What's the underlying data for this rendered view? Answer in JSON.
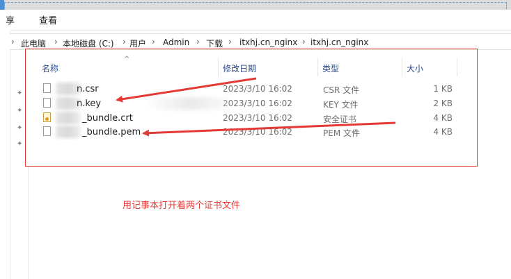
{
  "ribbon": {
    "tab1": "享",
    "tab2": "查看"
  },
  "breadcrumb": [
    "此电脑",
    "本地磁盘 (C:)",
    "用户",
    "Admin",
    "下载",
    "itxhj.cn_nginx",
    "itxhj.cn_nginx"
  ],
  "columns": {
    "name": "名称",
    "modified": "修改日期",
    "type": "类型",
    "size": "大小"
  },
  "files": [
    {
      "name": "n.csr",
      "modified": "2023/3/10 16:02",
      "type": "CSR 文件",
      "size": "1 KB",
      "icon": "file-icon"
    },
    {
      "name": "n.key",
      "modified": "2023/3/10 16:02",
      "type": "KEY 文件",
      "size": "2 KB",
      "icon": "file-icon"
    },
    {
      "name": "_bundle.crt",
      "modified": "2023/3/10 16:02",
      "type": "安全证书",
      "size": "4 KB",
      "icon": "certificate-icon"
    },
    {
      "name": "_bundle.pem",
      "modified": "2023/3/10 16:02",
      "type": "PEM 文件",
      "size": "4 KB",
      "icon": "file-icon"
    }
  ],
  "annotation": {
    "caption": "用记事本打开着两个证书文件",
    "color": "#e53935"
  }
}
